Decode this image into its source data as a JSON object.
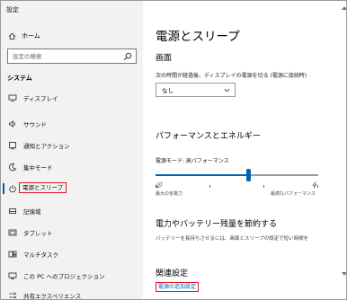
{
  "app_title": "設定",
  "sidebar": {
    "home_label": "ホーム",
    "search_placeholder": "設定の検索",
    "section_label": "システム",
    "items": [
      {
        "label": "ディスプレイ",
        "icon": "display-icon"
      },
      {
        "label": "サウンド",
        "icon": "speaker-icon"
      },
      {
        "label": "通知とアクション",
        "icon": "notification-icon"
      },
      {
        "label": "集中モード",
        "icon": "moon-icon"
      },
      {
        "label": "電源とスリープ",
        "icon": "power-icon",
        "active": true
      },
      {
        "label": "記憶域",
        "icon": "storage-icon"
      },
      {
        "label": "タブレット",
        "icon": "tablet-icon"
      },
      {
        "label": "マルチタスク",
        "icon": "multitask-icon"
      },
      {
        "label": "この PC へのプロジェクション",
        "icon": "projection-icon"
      },
      {
        "label": "共有エクスペリエンス",
        "icon": "share-icon"
      }
    ]
  },
  "main": {
    "title": "電源とスリープ",
    "screen_heading": "画面",
    "screen_timeout_label": "次の時間が経過後、ディスプレイの電源を切る (電源に接続時)",
    "screen_timeout_value": "なし",
    "perf_heading": "パフォーマンスとエネルギー",
    "power_mode_label": "電源モード: 高パフォーマンス",
    "power_mode_level": 0.57,
    "slider_left_caption": "最大の省電力",
    "slider_right_caption": "最適なパフォーマンス",
    "battery_heading": "電力やバッテリー残量を節約する",
    "battery_desc": "バッテリーを長持ちさせるには、画面とスリープの設定で短い時間を",
    "related_heading": "関連設定",
    "related_link": "電源の追加設定"
  },
  "colors": {
    "accent": "#0063b1",
    "highlight_box": "#e81123"
  }
}
